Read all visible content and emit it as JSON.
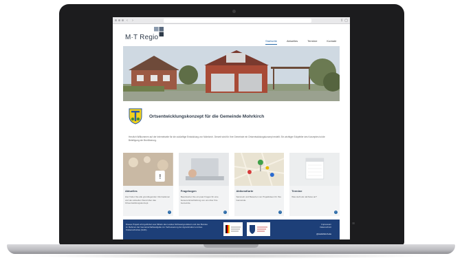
{
  "browser": {
    "url": "",
    "menu_glyph": "≡"
  },
  "site": {
    "logo_text": "M·T Regio",
    "nav": [
      "Startseite",
      "Aktuelles",
      "Termine",
      "Kontakt"
    ],
    "intro": {
      "title": "Ortsentwicklungskonzept für die Gemeinde Mohrkirch",
      "text": "Herzlich Willkommen auf der Internetseite für die zukünftige Entwicklung von Mohrkirch. Derzeit wird für Ihre Gemeinde ein Ortsentwicklungskonzept erstellt. Ein wichtiger Eckpfeiler des Konzeptes ist die Beteiligung der Bevölkerung."
    },
    "cards": [
      {
        "title": "Aktuelles",
        "desc": "Hier finden Sie alle grundlegenden Informationen und den aktuellen Stand über das Ortsentwicklungskonzept.",
        "icon": "arrow-right-icon"
      },
      {
        "title": "Fragebogen",
        "desc": "Beantworten Sie ein paar Fragen für eine bessere Einschätzung von uns über Ihre Gemeinde.",
        "icon": "arrow-right-icon"
      },
      {
        "title": "AktionsKarte",
        "desc": "Sammeln und Bewerten von Projektideen für Ihre Gemeinde.",
        "icon": "arrow-right-icon"
      },
      {
        "title": "Termine",
        "desc": "Was steht als nächstes an?",
        "icon": "arrow-right-icon"
      }
    ],
    "footer": {
      "text": "Dieses Projekt wird gefördert aus Mitteln des Landes Schleswig-Holstein und des Bundes im Rahmen der Gemeinschaftsaufgabe zur Verbesserung der Agrarstruktur und des Küstenschutzes (GAK).",
      "links": [
        "Impressum",
        "Datenschutz"
      ],
      "email": "@mohrkirch.de"
    }
  },
  "colors": {
    "nav_active": "#2a6aa8",
    "footer_bg": "#1d3f78",
    "card_bg": "#f2f3f4",
    "crest_yellow": "#f2d21b",
    "crest_blue": "#2a5aa8"
  }
}
